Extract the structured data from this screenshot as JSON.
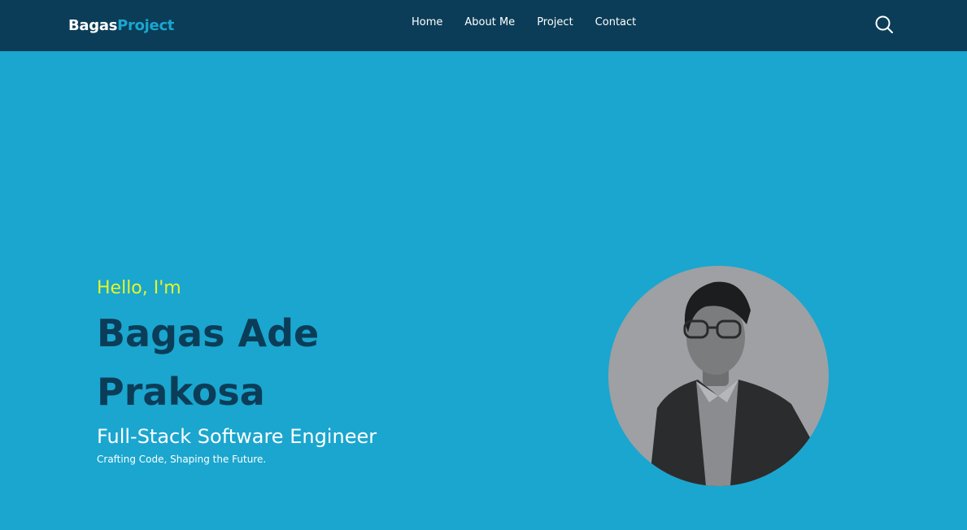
{
  "nav": {
    "logo_part1": "Bagas",
    "logo_part2": "Project",
    "links": [
      "Home",
      "About Me",
      "Project",
      "Contact"
    ],
    "search_icon": "search-icon"
  },
  "hero": {
    "greeting": "Hello, I'm",
    "name": "Bagas Ade Prakosa",
    "role": "Full-Stack Software Engineer",
    "tagline": "Crafting Code, Shaping the Future."
  },
  "colors": {
    "navbar_bg": "#0b3d58",
    "hero_bg": "#1aa6cf",
    "greeting": "#e6f526",
    "name": "#0b3d58",
    "photo_bg": "#9ea0a3"
  }
}
